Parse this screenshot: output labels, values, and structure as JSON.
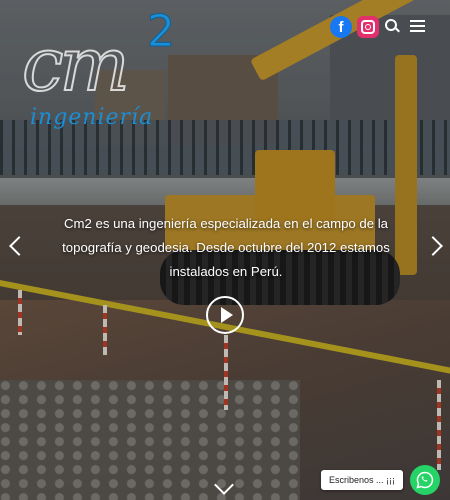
{
  "brand": {
    "logo_main": "cm",
    "logo_sup": "2",
    "logo_sub": "ingeniería",
    "accent": "#1b8fd6"
  },
  "header": {
    "icons": [
      "facebook-icon",
      "instagram-icon",
      "search-icon",
      "hamburger-menu-icon"
    ],
    "facebook_glyph": "f"
  },
  "hero": {
    "caption": "Cm2 es una ingeniería especializada en el campo de la topografía y geodesia. Desde octubre del 2012 estamos instalados en Perú.",
    "controls": [
      "arrow-left-icon",
      "arrow-right-icon",
      "play-icon",
      "chevron-down-icon"
    ]
  },
  "chat": {
    "label": "Escribenos ... ¡¡¡",
    "color": "#25d366"
  }
}
